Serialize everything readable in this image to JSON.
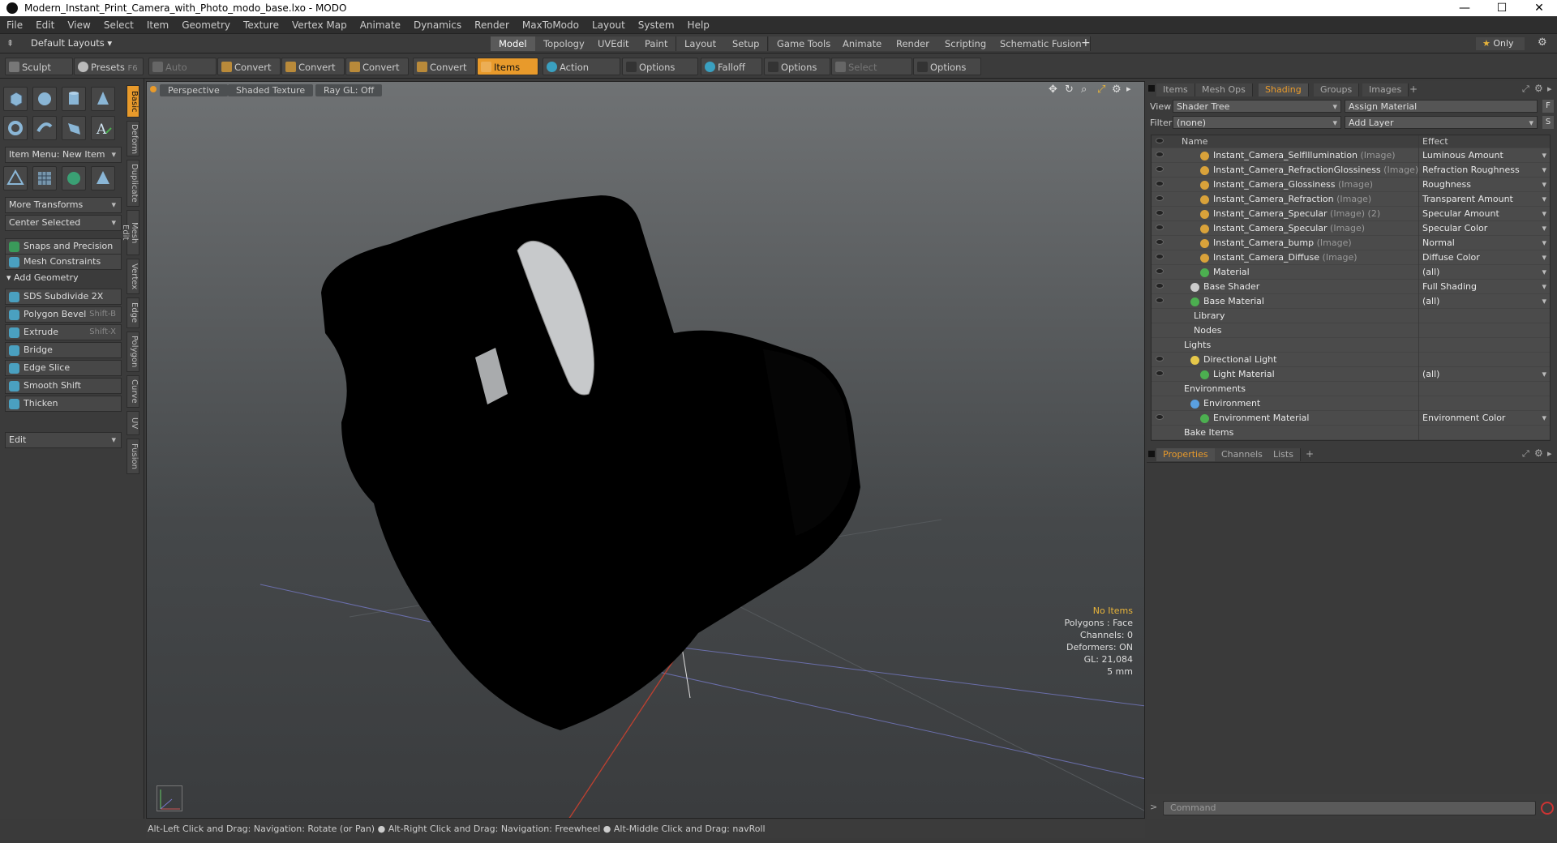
{
  "window": {
    "title": "Modern_Instant_Print_Camera_with_Photo_modo_base.lxo - MODO"
  },
  "menu": [
    "File",
    "Edit",
    "View",
    "Select",
    "Item",
    "Geometry",
    "Texture",
    "Vertex Map",
    "Animate",
    "Dynamics",
    "Render",
    "MaxToModo",
    "Layout",
    "System",
    "Help"
  ],
  "layouts": {
    "preset": "Default Layouts",
    "tabs": [
      "Model",
      "Topology",
      "UVEdit",
      "Paint",
      "Layout",
      "Setup",
      "Game Tools",
      "Animate",
      "Render",
      "Scripting",
      "Schematic Fusion"
    ],
    "active": "Model",
    "only": "Only"
  },
  "toolbar": {
    "sculpt": "Sculpt",
    "presets": "Presets",
    "presets_key": "F6",
    "auto_select": "Auto Select",
    "convert": "Convert",
    "items": "Items",
    "action_center": "Action Center",
    "options": "Options",
    "falloff": "Falloff",
    "select_through": "Select Through"
  },
  "left": {
    "item_menu": "Item Menu: New Item",
    "more_transforms": "More Transforms",
    "center_selected": "Center Selected",
    "snaps": "Snaps and Precision",
    "mesh_constraints": "Mesh Constraints",
    "add_geometry": "Add Geometry",
    "tools": [
      {
        "label": "SDS Subdivide 2X",
        "key": ""
      },
      {
        "label": "Polygon Bevel",
        "key": "Shift-B"
      },
      {
        "label": "Extrude",
        "key": "Shift-X"
      },
      {
        "label": "Bridge",
        "key": ""
      },
      {
        "label": "Edge Slice",
        "key": ""
      },
      {
        "label": "Smooth Shift",
        "key": ""
      },
      {
        "label": "Thicken",
        "key": ""
      }
    ],
    "edit": "Edit",
    "vtabs": [
      "Basic",
      "Deform",
      "Duplicate",
      "Mesh Edit",
      "Vertex",
      "Edge",
      "Polygon",
      "Curve",
      "UV",
      "Fusion"
    ]
  },
  "viewport": {
    "buttons": [
      "Perspective",
      "Shaded Texture",
      "Ray GL: Off"
    ],
    "info": {
      "no_items": "No Items",
      "polygons": "Polygons : Face",
      "channels": "Channels: 0",
      "deformers": "Deformers: ON",
      "gl": "GL: 21,084",
      "scale": "5 mm"
    }
  },
  "status": "Alt-Left Click and Drag: Navigation: Rotate (or Pan) ● Alt-Right Click and Drag: Navigation: Freewheel ● Alt-Middle Click and Drag: navRoll",
  "right": {
    "tabs": [
      "Items",
      "Mesh Ops",
      "Shading",
      "Groups",
      "Images"
    ],
    "active": "Shading",
    "view_label": "View",
    "view_value": "Shader Tree",
    "assign": "Assign Material",
    "filter_label": "Filter",
    "filter_value": "(none)",
    "add_layer": "Add Layer",
    "col_name": "Name",
    "col_effect": "Effect",
    "rows": [
      {
        "name": "Instant_Camera_SelfIllumination",
        "type": "(Image)",
        "effect": "Luminous Amount",
        "indent": 62,
        "eye": true,
        "dot": "#d9a23a",
        "dd": true
      },
      {
        "name": "Instant_Camera_RefractionGlossiness",
        "type": "(Image)",
        "effect": "Refraction Roughness",
        "indent": 62,
        "eye": true,
        "dot": "#d9a23a",
        "dd": true
      },
      {
        "name": "Instant_Camera_Glossiness",
        "type": "(Image)",
        "effect": "Roughness",
        "indent": 62,
        "eye": true,
        "dot": "#d9a23a",
        "dd": true
      },
      {
        "name": "Instant_Camera_Refraction",
        "type": "(Image)",
        "effect": "Transparent Amount",
        "indent": 62,
        "eye": true,
        "dot": "#d9a23a",
        "dd": true
      },
      {
        "name": "Instant_Camera_Specular",
        "type": "(Image) (2)",
        "effect": "Specular Amount",
        "indent": 62,
        "eye": true,
        "dot": "#d9a23a",
        "dd": true
      },
      {
        "name": "Instant_Camera_Specular",
        "type": "(Image)",
        "effect": "Specular Color",
        "indent": 62,
        "eye": true,
        "dot": "#d9a23a",
        "dd": true
      },
      {
        "name": "Instant_Camera_bump",
        "type": "(Image)",
        "effect": "Normal",
        "indent": 62,
        "eye": true,
        "dot": "#d9a23a",
        "dd": true
      },
      {
        "name": "Instant_Camera_Diffuse",
        "type": "(Image)",
        "effect": "Diffuse Color",
        "indent": 62,
        "eye": true,
        "dot": "#d9a23a",
        "dd": true
      },
      {
        "name": "Material",
        "type": "",
        "effect": "(all)",
        "indent": 62,
        "eye": true,
        "dot": "#4caf50",
        "dd": true
      },
      {
        "name": "Base Shader",
        "type": "",
        "effect": "Full Shading",
        "indent": 50,
        "eye": true,
        "dot": "#ccc",
        "dd": true
      },
      {
        "name": "Base Material",
        "type": "",
        "effect": "(all)",
        "indent": 50,
        "eye": true,
        "dot": "#4caf50",
        "dd": true
      },
      {
        "name": "Library",
        "type": "",
        "effect": "",
        "indent": 40,
        "eye": false,
        "dot": "",
        "dd": false
      },
      {
        "name": "Nodes",
        "type": "",
        "effect": "",
        "indent": 40,
        "eye": false,
        "dot": "",
        "dd": false
      },
      {
        "name": "Lights",
        "type": "",
        "effect": "",
        "indent": 28,
        "eye": false,
        "dot": "",
        "dd": false
      },
      {
        "name": "Directional Light",
        "type": "",
        "effect": "",
        "indent": 50,
        "eye": true,
        "dot": "#e6c84a",
        "dd": false
      },
      {
        "name": "Light Material",
        "type": "",
        "effect": "(all)",
        "indent": 62,
        "eye": true,
        "dot": "#4caf50",
        "dd": true
      },
      {
        "name": "Environments",
        "type": "",
        "effect": "",
        "indent": 28,
        "eye": false,
        "dot": "",
        "dd": false
      },
      {
        "name": "Environment",
        "type": "",
        "effect": "",
        "indent": 50,
        "eye": false,
        "dot": "#5aa0e0",
        "dd": false
      },
      {
        "name": "Environment Material",
        "type": "",
        "effect": "Environment Color",
        "indent": 62,
        "eye": true,
        "dot": "#4caf50",
        "dd": true
      },
      {
        "name": "Bake Items",
        "type": "",
        "effect": "",
        "indent": 28,
        "eye": false,
        "dot": "",
        "dd": false
      }
    ],
    "bottom_tabs": [
      "Properties",
      "Channels",
      "Lists"
    ],
    "command": "Command"
  }
}
